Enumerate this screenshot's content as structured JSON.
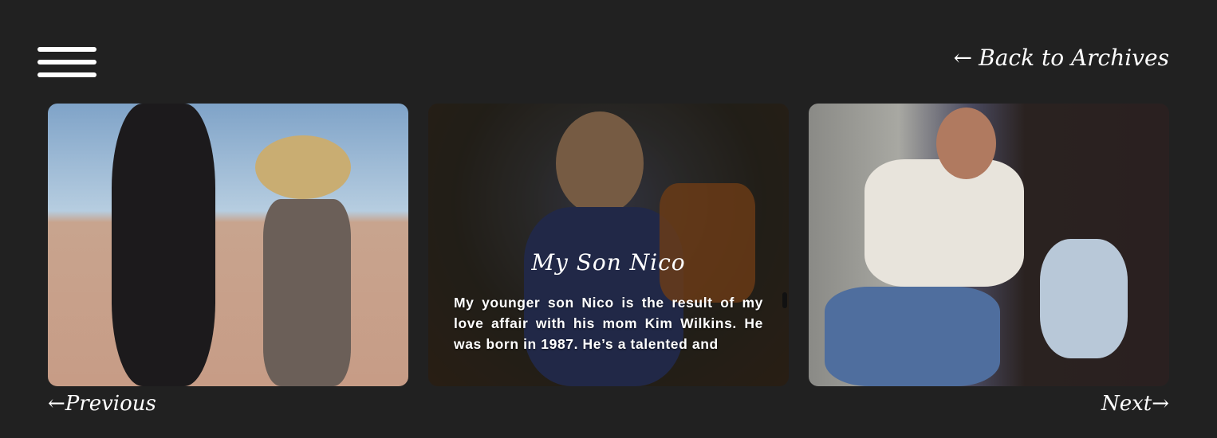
{
  "header": {
    "menu_icon": "hamburger-icon",
    "back_label": "Back to Archives",
    "back_icon": "arrow-left-icon"
  },
  "cards": [
    {
      "alt": "Child in cowboy hat with pony"
    },
    {
      "title": "My Son Nico",
      "description": "My younger son Nico is the result of my love affair with his mom Kim Wilkins. He was born in 1987. He’s a talented and"
    },
    {
      "alt": "Father and son eating cake"
    }
  ],
  "footer": {
    "previous_label": "←Previous",
    "next_label": "Next→"
  }
}
